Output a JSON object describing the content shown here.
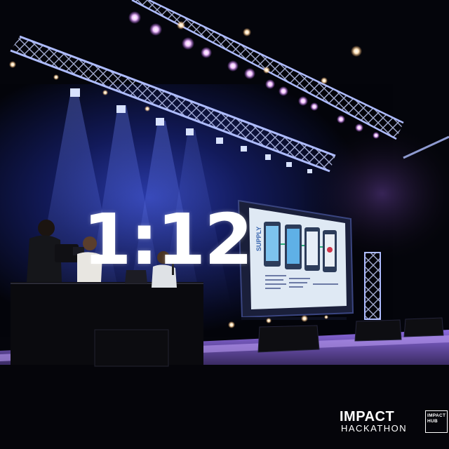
{
  "stage": {
    "countdown": "1:12"
  },
  "slide": {
    "side_label": "SUPPLY"
  },
  "branding": {
    "event_line1": "IMPACT",
    "event_line2": "HACKATHON",
    "hub_line1": "IMPACT",
    "hub_line2": "HUB"
  },
  "colors": {
    "background": "#05060d",
    "stage_blue": "#1a2a8a",
    "screen_glow": "#3b4fd0",
    "slide_bg": "#dfe9f4",
    "stage_floor_glow": "#7a5cd6",
    "spotlight_warm": "#ffd9a0"
  }
}
